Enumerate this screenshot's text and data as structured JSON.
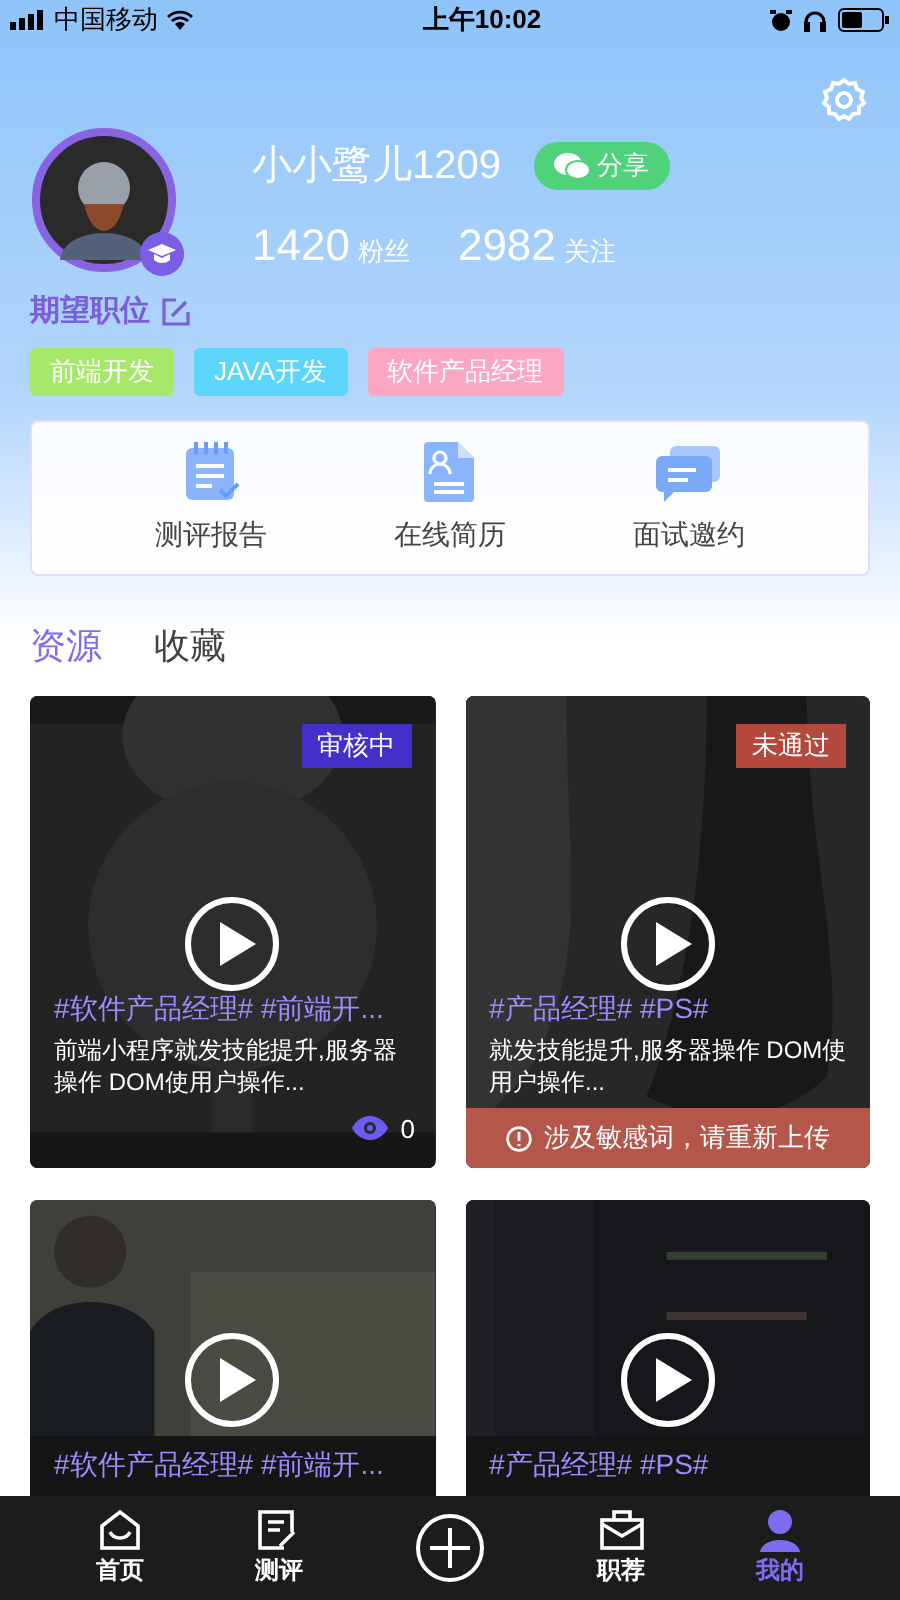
{
  "status_bar": {
    "carrier": "中国移动",
    "time": "上午10:02"
  },
  "profile": {
    "name": "小小鹭儿1209",
    "share": "分享",
    "fans_count": "1420",
    "fans_label": "粉丝",
    "follow_count": "2982",
    "follow_label": "关注"
  },
  "expected_position": {
    "title": "期望职位",
    "tags": [
      {
        "label": "前端开发",
        "color": "#a6e86a"
      },
      {
        "label": "JAVA开发",
        "color": "#5cd6fb"
      },
      {
        "label": "软件产品经理",
        "color": "#fca6c2"
      }
    ]
  },
  "shortcuts": [
    {
      "label": "测评报告",
      "kind": "report"
    },
    {
      "label": "在线简历",
      "kind": "resume"
    },
    {
      "label": "面试邀约",
      "kind": "chat"
    }
  ],
  "tabs": [
    {
      "label": "资源",
      "selected": true
    },
    {
      "label": "收藏",
      "selected": false
    }
  ],
  "videos": [
    {
      "topics": "#软件产品经理# #前端开...",
      "description": "前端小程序就发技能提升,服务器操作 DOM使用户操作...",
      "badge": {
        "label": "审核中",
        "kind": "reviewing"
      },
      "views": "0"
    },
    {
      "topics": "#产品经理# #PS#",
      "description": "就发技能提升,服务器操作 DOM使用户操作...",
      "badge": {
        "label": "未通过",
        "kind": "rejected"
      },
      "notice": "涉及敏感词，请重新上传"
    },
    {
      "topics": "#软件产品经理# #前端开..."
    },
    {
      "topics": "#产品经理# #PS#"
    }
  ],
  "tab_bar": [
    {
      "label": "首页",
      "kind": "home",
      "selected": false
    },
    {
      "label": "测评",
      "kind": "test",
      "selected": false
    },
    {
      "kind": "add"
    },
    {
      "label": "职荐",
      "kind": "jobs",
      "selected": false
    },
    {
      "label": "我的",
      "kind": "me",
      "selected": true
    }
  ]
}
